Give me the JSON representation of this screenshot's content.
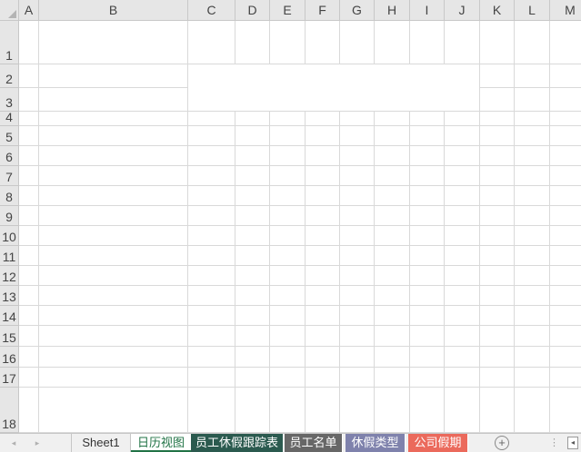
{
  "columns": [
    "A",
    "B",
    "C",
    "D",
    "E",
    "F",
    "G",
    "H",
    "I",
    "J",
    "K",
    "L",
    "M"
  ],
  "rows": [
    "1",
    "2",
    "3",
    "4",
    "5",
    "6",
    "7",
    "8",
    "9",
    "10",
    "11",
    "12",
    "13",
    "14",
    "15",
    "16",
    "17",
    "18"
  ],
  "sheet_tabs": [
    {
      "label": "Sheet1",
      "style": "plain",
      "color": "#f0f0f0"
    },
    {
      "label": "日历视图",
      "style": "active",
      "color": "#ffffff"
    },
    {
      "label": "员工休假跟踪表",
      "style": "colored",
      "color": "#2b5a4f"
    },
    {
      "label": "员工名单",
      "style": "colored",
      "color": "#676767"
    },
    {
      "label": "休假类型",
      "style": "colored",
      "color": "#7f82ac"
    },
    {
      "label": "公司假期",
      "style": "colored",
      "color": "#eb6a5c"
    }
  ],
  "tabbar": {
    "prev_sheet_icon": "◂",
    "next_sheet_icon": "▸",
    "add_sheet_icon": "+",
    "more_icon": "⋮",
    "scroll_left_icon": "◂"
  }
}
